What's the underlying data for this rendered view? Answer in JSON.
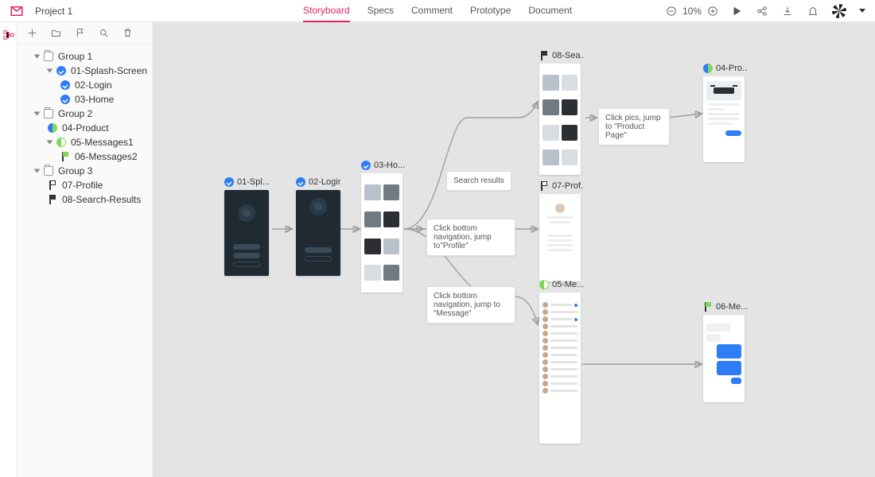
{
  "project_name": "Project 1",
  "tabs": [
    "Storyboard",
    "Specs",
    "Comment",
    "Prototype",
    "Document"
  ],
  "active_tab": 0,
  "zoom_label": "10%",
  "tree": {
    "groups": [
      {
        "name": "Group 1",
        "children": [
          {
            "name": "01-Splash-Screen",
            "badge": "check",
            "children": [
              {
                "name": "02-Login",
                "badge": "check"
              },
              {
                "name": "03-Home",
                "badge": "check"
              }
            ]
          }
        ]
      },
      {
        "name": "Group 2",
        "children": [
          {
            "name": "04-Product",
            "badge": "half"
          },
          {
            "name": "05-Messages1",
            "badge": "half2",
            "children": [
              {
                "name": "06-Messages2",
                "badge": "flag-green"
              }
            ]
          }
        ]
      },
      {
        "name": "Group 3",
        "children": [
          {
            "name": "07-Profile",
            "badge": "flag-outline"
          },
          {
            "name": "08-Search-Results",
            "badge": "flag-dark"
          }
        ]
      }
    ]
  },
  "canvas": {
    "nodes": {
      "splash": {
        "label": "01-Spl..."
      },
      "login": {
        "label": "02-Login"
      },
      "home": {
        "label": "03-Ho..."
      },
      "search": {
        "label": "08-Sea..."
      },
      "profile": {
        "label": "07-Prof..."
      },
      "messages": {
        "label": "05-Me..."
      },
      "product": {
        "label": "04-Pro..."
      },
      "chat": {
        "label": "06-Me..."
      }
    },
    "notes": {
      "n_search": "Search results",
      "n_profile": "Click bottom navigation,  jump to\"Profile\"",
      "n_message": "Click bottom navigation, jump to \"Message\"",
      "n_product": "Click pics, jump to \"Product Page\""
    }
  }
}
